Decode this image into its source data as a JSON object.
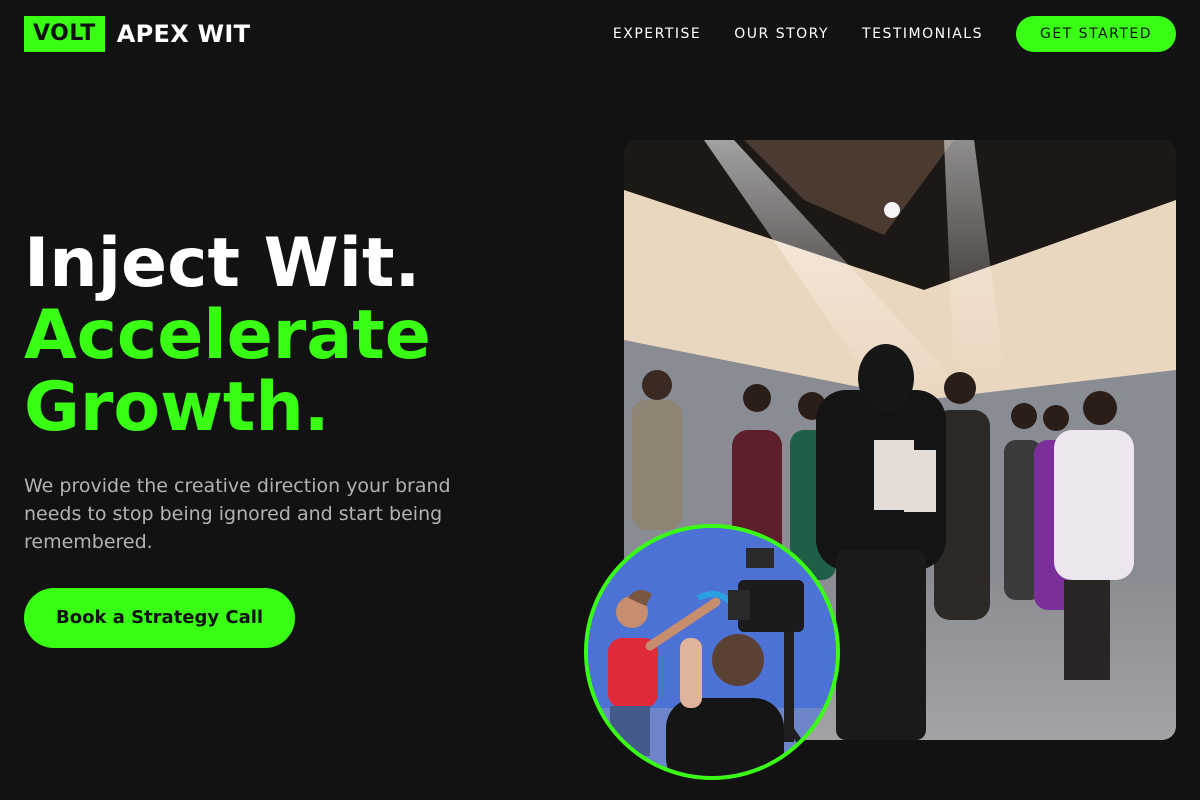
{
  "brand": {
    "badge": "VOLT",
    "name": "APEX WIT",
    "accent": "#39ff14"
  },
  "nav": {
    "links": [
      "EXPERTISE",
      "OUR STORY",
      "TESTIMONIALS"
    ],
    "cta": "GET STARTED"
  },
  "hero": {
    "headline_line1": "Inject Wit.",
    "headline_line2": "Accelerate",
    "headline_line3": "Growth.",
    "subtext": "We provide the creative direction your brand needs to stop being ignored and start being remembered.",
    "cta": "Book a Strategy Call"
  },
  "images": {
    "main_alt": "Fashion show backstage with models under spotlights",
    "inset_alt": "Film crew shooting with camera in front of blue backdrop"
  }
}
